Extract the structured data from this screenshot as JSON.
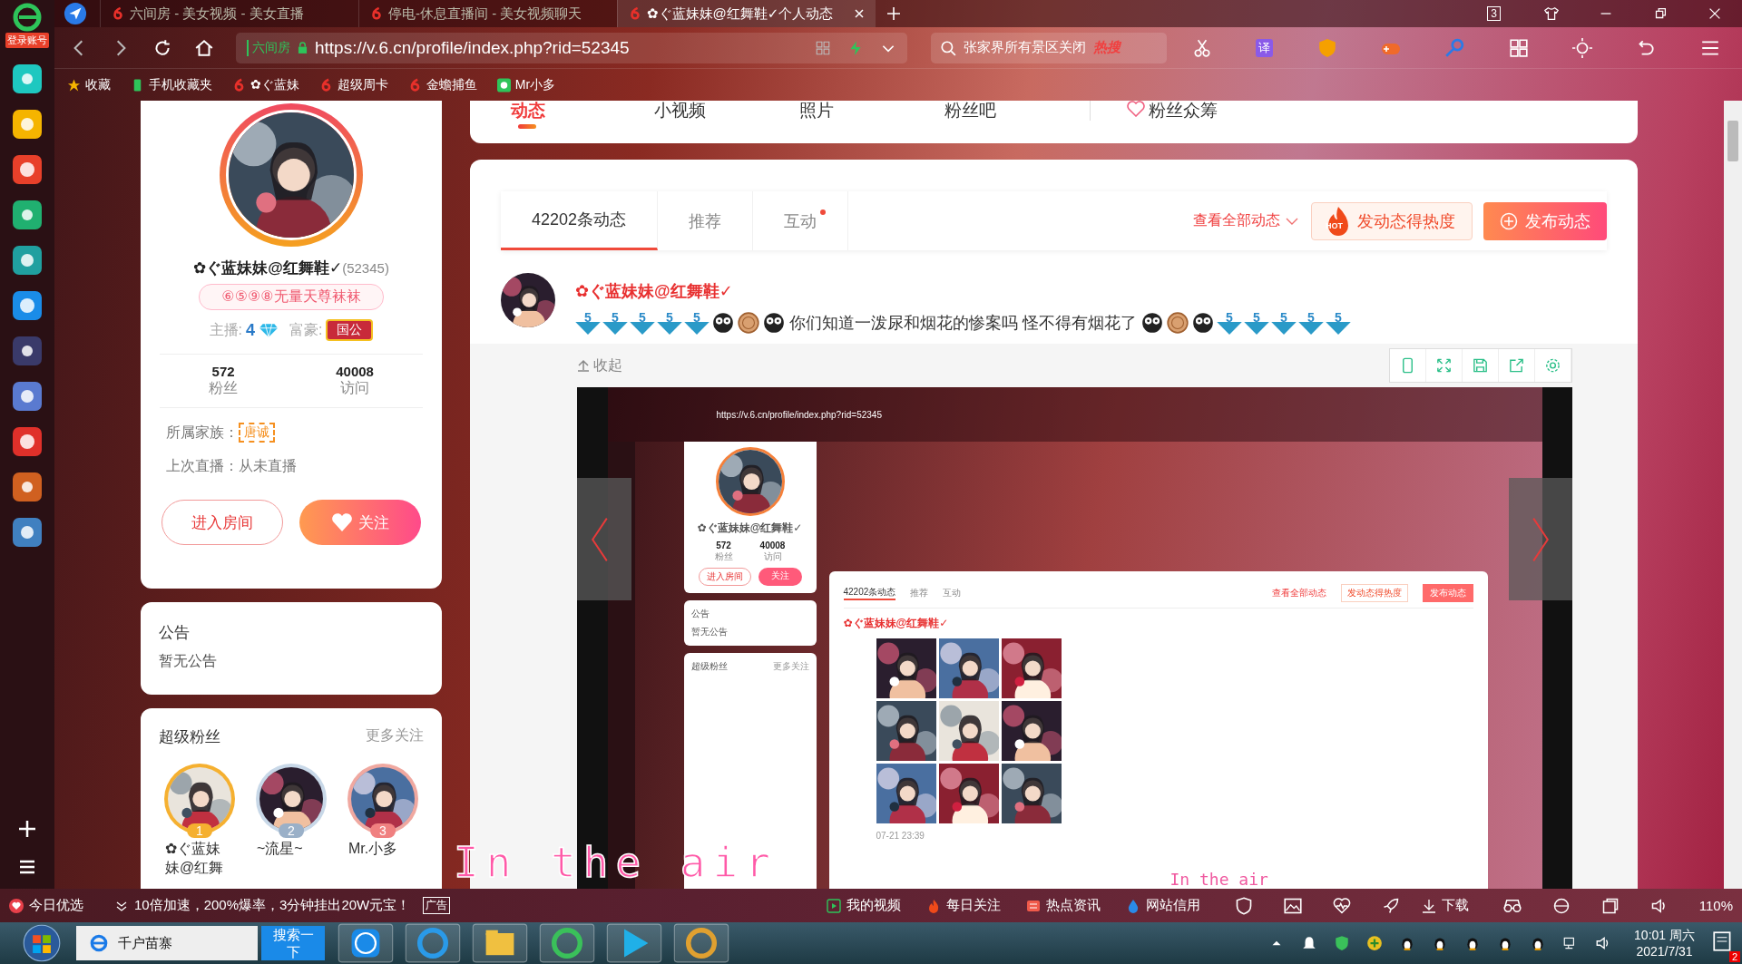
{
  "browser": {
    "login_label": "登录账号",
    "tabs": [
      {
        "title": "六间房 - 美女视频 - 美女直播",
        "selected": false
      },
      {
        "title": "停电-休息直播间 - 美女视频聊天",
        "selected": false
      },
      {
        "title": "✿ぐ蓝妹妹@红舞鞋✓个人动态",
        "selected": true
      }
    ],
    "window_count": "3",
    "address": {
      "site_badge": "六间房",
      "url": "https://v.6.cn/profile/index.php?rid=52345"
    },
    "search": {
      "value": "张家界所有景区关闭",
      "hot_label": "热搜"
    },
    "translate_label": "译",
    "bookmarks": [
      "收藏",
      "手机收藏夹",
      "✿ぐ蓝妹",
      "超级周卡",
      "金蟾捕鱼",
      "Mr小多"
    ]
  },
  "profile": {
    "name": "✿ぐ蓝妹妹@红舞鞋✓",
    "rid": "(52345)",
    "badge": "⑥⑤⑨⑧无量天尊袜袜",
    "anchor_label": "主播:",
    "anchor_level": "4",
    "rich_label": "富豪:",
    "rich_title": "国公",
    "stats": [
      {
        "value": "572",
        "label": "粉丝"
      },
      {
        "value": "40008",
        "label": "访问"
      }
    ],
    "family_label": "所属家族：",
    "family": "唐诚",
    "last_live": "上次直播：从未直播",
    "enter_button": "进入房间",
    "follow_button": "关注"
  },
  "notice": {
    "title": "公告",
    "body": "暂无公告"
  },
  "super_fans": {
    "title": "超级粉丝",
    "more": "更多关注",
    "fans": [
      {
        "name": "✿ぐ蓝妹妹@红舞",
        "rank": "1"
      },
      {
        "name": "~流星~",
        "rank": "2"
      },
      {
        "name": "Mr.小多",
        "rank": "3"
      }
    ]
  },
  "top_nav": [
    {
      "label": "动态",
      "selected": true
    },
    {
      "label": "小视频",
      "selected": false
    },
    {
      "label": "照片",
      "selected": false
    },
    {
      "label": "粉丝吧",
      "selected": false
    },
    {
      "label": "粉丝众筹",
      "selected": false
    }
  ],
  "feed": {
    "tabs": [
      {
        "label": "42202条动态",
        "selected": true,
        "dot": false
      },
      {
        "label": "推荐",
        "selected": false,
        "dot": false
      },
      {
        "label": "互动",
        "selected": false,
        "dot": true
      }
    ],
    "view_all": "查看全部动态",
    "hot_badge": "HOT",
    "hot_button": "发动态得热度",
    "post_button": "发布动态",
    "post": {
      "author": "✿ぐ蓝妹妹@红舞鞋✓",
      "badges_before": [
        "5",
        "5",
        "5",
        "5",
        "5"
      ],
      "text": "你们知道一泼尿和烟花的惨案吗 怪不得有烟花了",
      "badges_after": [
        "5",
        "5",
        "5",
        "5",
        "5"
      ],
      "collapse": "收起"
    }
  },
  "embedded_screenshot": {
    "url": "https://v.6.cn/profile/index.php?rid=52345",
    "name": "✿ぐ蓝妹妹@红舞鞋✓",
    "stats": [
      {
        "value": "572",
        "label": "粉丝"
      },
      {
        "value": "40008",
        "label": "访问"
      }
    ],
    "enter_button": "进入房间",
    "follow_button": "关注",
    "notice_title": "公告",
    "notice_body": "暂无公告",
    "fans_title": "超级粉丝",
    "fans_more": "更多关注",
    "tabs": [
      {
        "label": "42202条动态",
        "selected": true
      },
      {
        "label": "推荐",
        "selected": false
      },
      {
        "label": "互动",
        "selected": false
      }
    ],
    "view_all": "查看全部动态",
    "hot_button": "发动态得热度",
    "post_button": "发布动态",
    "author": "✿ぐ蓝妹妹@红舞鞋✓",
    "timestamp": "07-21 23:39",
    "lyric": "In the air"
  },
  "lyric": "In the air",
  "status_bar": {
    "promo_label": "今日优选",
    "promo_text": "10倍加速，200%爆率，3分钟挂出20W元宝！",
    "ad_label": "广告",
    "links": [
      "我的视频",
      "每日关注",
      "热点资讯",
      "网站信用"
    ],
    "download": "下载",
    "zoom": "110%"
  },
  "taskbar": {
    "search_value": "千户苗寨",
    "search_button": "搜索一下",
    "time": "10:01 周六",
    "date": "2021/7/31",
    "notifications": "2"
  }
}
